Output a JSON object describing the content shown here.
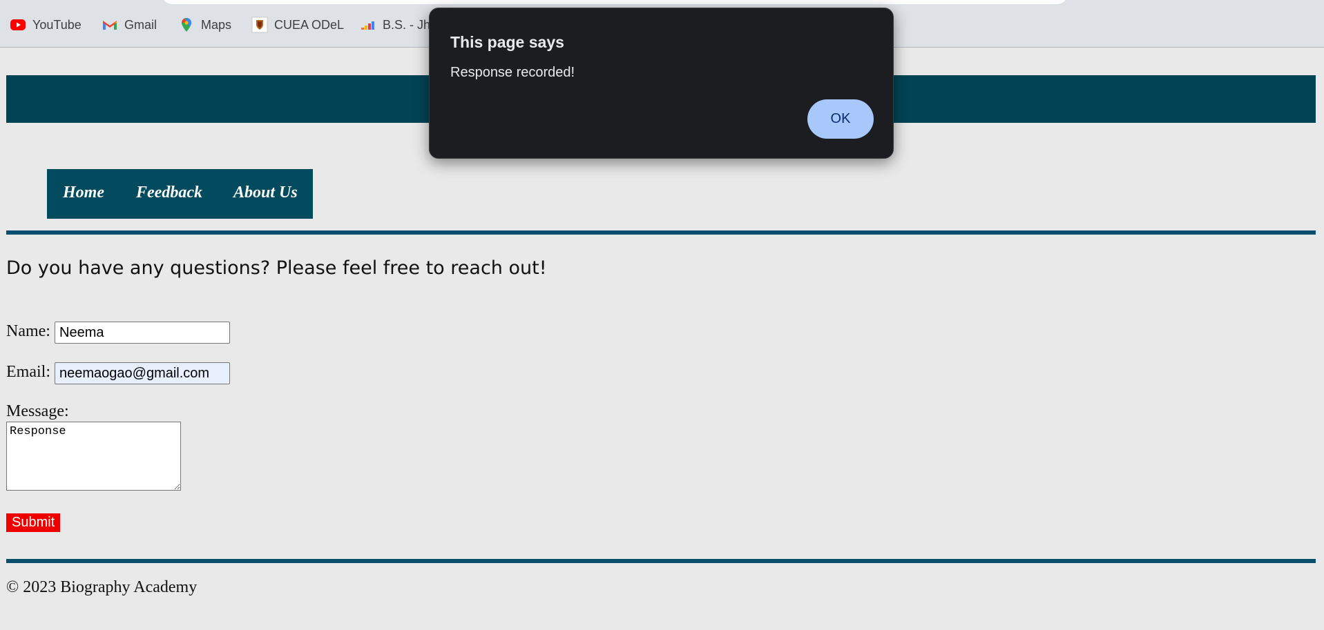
{
  "browser": {
    "bookmarks": [
      {
        "label": "YouTube",
        "icon": "youtube-icon"
      },
      {
        "label": "Gmail",
        "icon": "gmail-icon"
      },
      {
        "label": "Maps",
        "icon": "maps-icon"
      },
      {
        "label": "CUEA ODeL",
        "icon": "cuea-crest-icon"
      },
      {
        "label": "B.S. - Jhe",
        "icon": "deezer-bars-icon"
      }
    ]
  },
  "page": {
    "nav": {
      "home": "Home",
      "feedback": "Feedback",
      "about": "About Us"
    },
    "heading": "Do you have any questions? Please feel free to reach out!",
    "form": {
      "name_label": "Name:",
      "name_value": "Neema",
      "email_label": "Email:",
      "email_value": "neemaogao@gmail.com",
      "message_label": "Message:",
      "message_value": "Response",
      "submit_label": "Submit"
    },
    "footer": "© 2023 Biography Academy"
  },
  "dialog": {
    "title": "This page says",
    "message": "Response recorded!",
    "ok_label": "OK"
  },
  "colors": {
    "banner": "#004455",
    "nav_background": "#024b5e",
    "rule": "#0a4f6e",
    "submit_button": "#ee0000",
    "dialog_background": "#1c1d21",
    "dialog_ok_button": "#a8c7fa"
  }
}
